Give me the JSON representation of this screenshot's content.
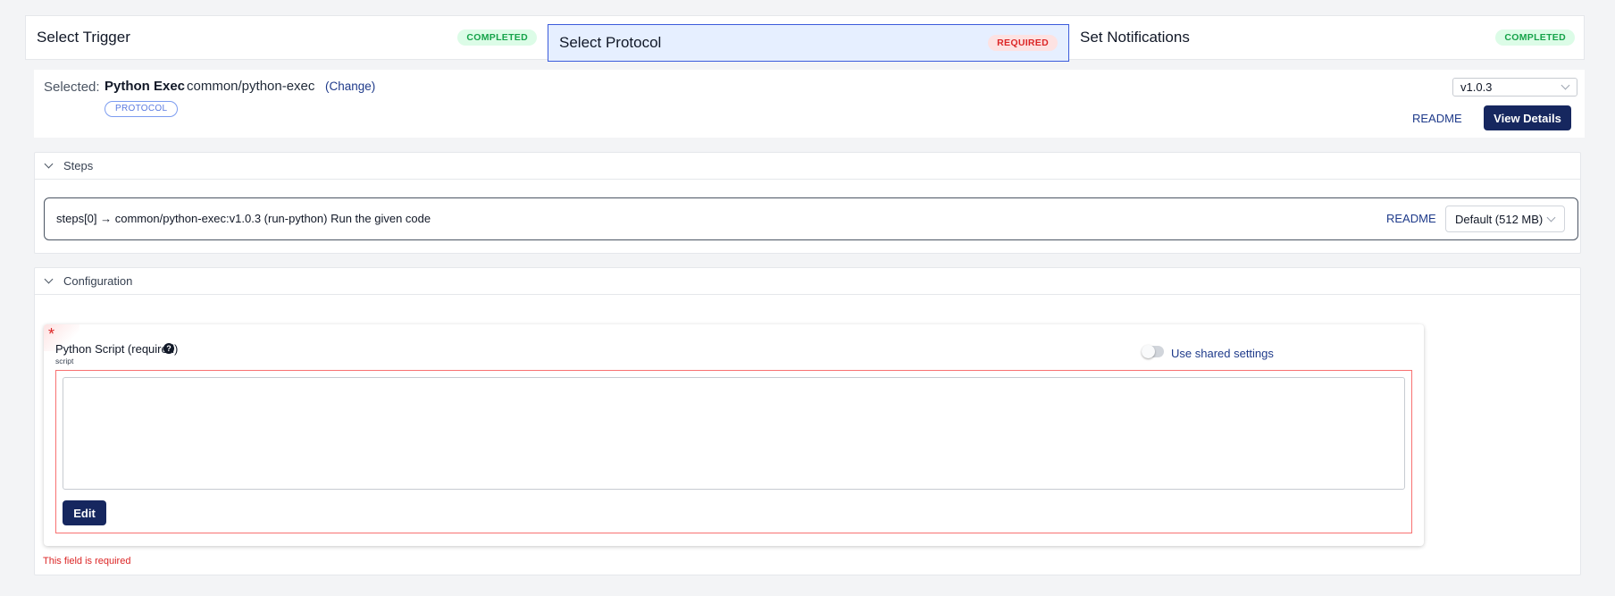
{
  "stepper": {
    "steps": [
      {
        "title": "Select Trigger",
        "status": "COMPLETED"
      },
      {
        "title": "Select Protocol",
        "status": "REQUIRED"
      },
      {
        "title": "Set Notifications",
        "status": "COMPLETED"
      }
    ]
  },
  "selected": {
    "label": "Selected:",
    "name": "Python Exec",
    "path": "common/python-exec",
    "change_label": "(Change)",
    "type_pill": "PROTOCOL",
    "version": "v1.0.3",
    "readme_label": "README",
    "view_details_label": "View Details"
  },
  "steps_panel": {
    "title": "Steps",
    "row_text": "steps[0] → common/python-exec:v1.0.3 (run-python) Run the given code",
    "readme_label": "README",
    "memory_option": "Default (512 MB)"
  },
  "config_panel": {
    "title": "Configuration",
    "required_marker": "*",
    "field_label": "Python Script (required)",
    "field_key": "script",
    "help_glyph": "?",
    "shared_settings_label": "Use shared settings",
    "script_value": "",
    "edit_label": "Edit",
    "error_message": "This field is required"
  },
  "colors": {
    "accent": "#16275f",
    "completed": "#16a34a",
    "required": "#dc2626",
    "active_step_bg": "#e6efff"
  }
}
